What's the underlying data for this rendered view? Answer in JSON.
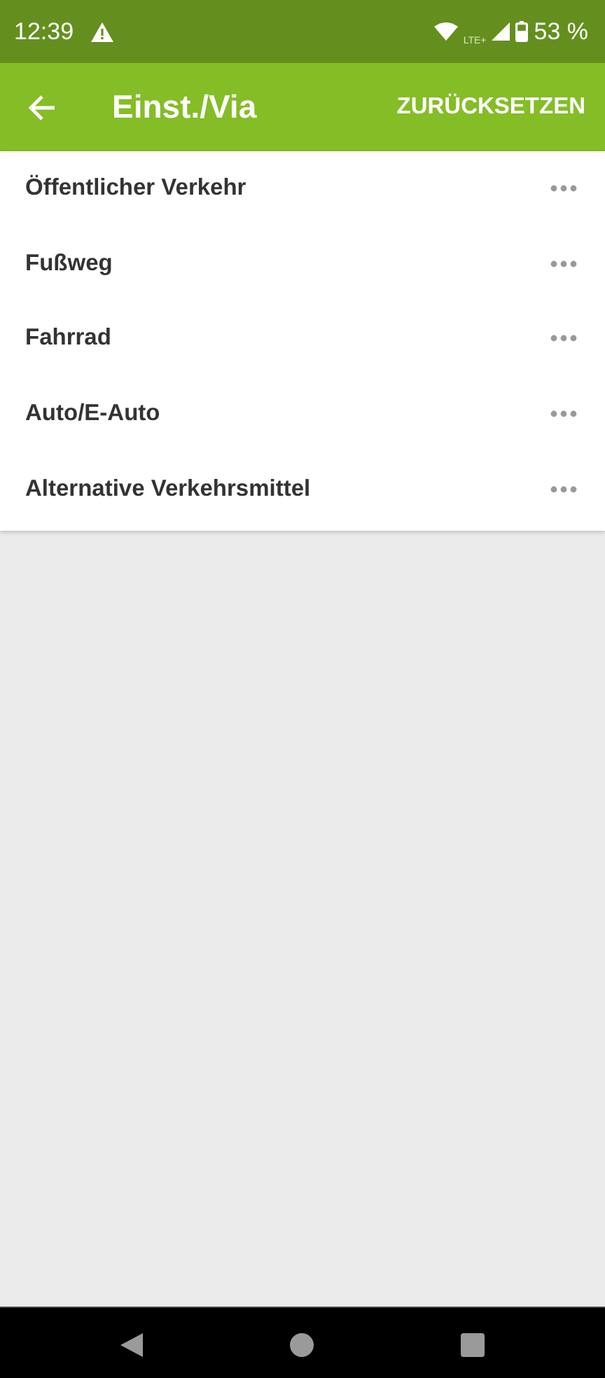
{
  "status_bar": {
    "time": "12:39",
    "network": "LTE+",
    "battery": "53 %"
  },
  "app_bar": {
    "title": "Einst./Via",
    "action": "ZURÜCKSETZEN"
  },
  "items": [
    {
      "label": "Öffentlicher Verkehr"
    },
    {
      "label": "Fußweg"
    },
    {
      "label": "Fahrrad"
    },
    {
      "label": "Auto/E-Auto"
    },
    {
      "label": "Alternative Verkehrsmittel"
    }
  ]
}
